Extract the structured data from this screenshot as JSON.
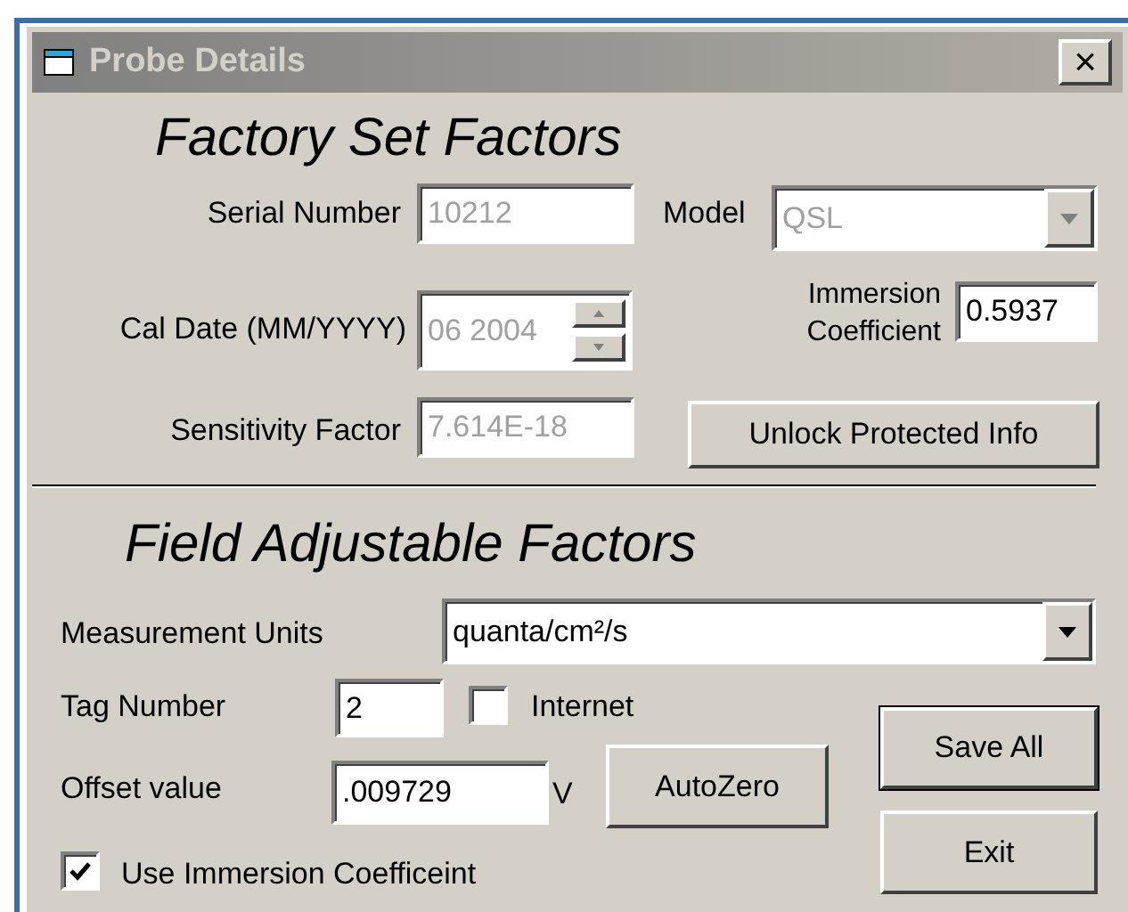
{
  "window": {
    "title": "Probe Details",
    "close_label": "×"
  },
  "factory_section": {
    "heading": "Factory Set Factors",
    "serial_number": {
      "label": "Serial Number",
      "value": "10212",
      "disabled": true
    },
    "model": {
      "label": "Model",
      "value": "QSL",
      "disabled": true
    },
    "cal_date": {
      "label": "Cal Date (MM/YYYY)",
      "value": "06 2004",
      "disabled": true
    },
    "immersion_coefficient": {
      "label": "Immersion Coefficient",
      "value": "0.5937",
      "disabled": false
    },
    "sensitivity_factor": {
      "label": "Sensitivity  Factor",
      "value": "7.614E-18",
      "disabled": true
    },
    "unlock_button": "Unlock Protected Info"
  },
  "field_section": {
    "heading": "Field Adjustable Factors",
    "measurement_units": {
      "label": "Measurement Units",
      "value": "quanta/cm²/s"
    },
    "tag_number": {
      "label": "Tag Number",
      "value": "2"
    },
    "internet": {
      "label": "Internet",
      "checked": false
    },
    "offset_value": {
      "label": "Offset value",
      "value": ".009729",
      "unit": "V"
    },
    "autozero_button": "AutoZero",
    "use_immersion": {
      "label": "Use Immersion Coefficeint",
      "checked": true
    }
  },
  "buttons": [
    {
      "label": "Save All",
      "default": true
    },
    {
      "label": "Exit",
      "default": false
    }
  ]
}
